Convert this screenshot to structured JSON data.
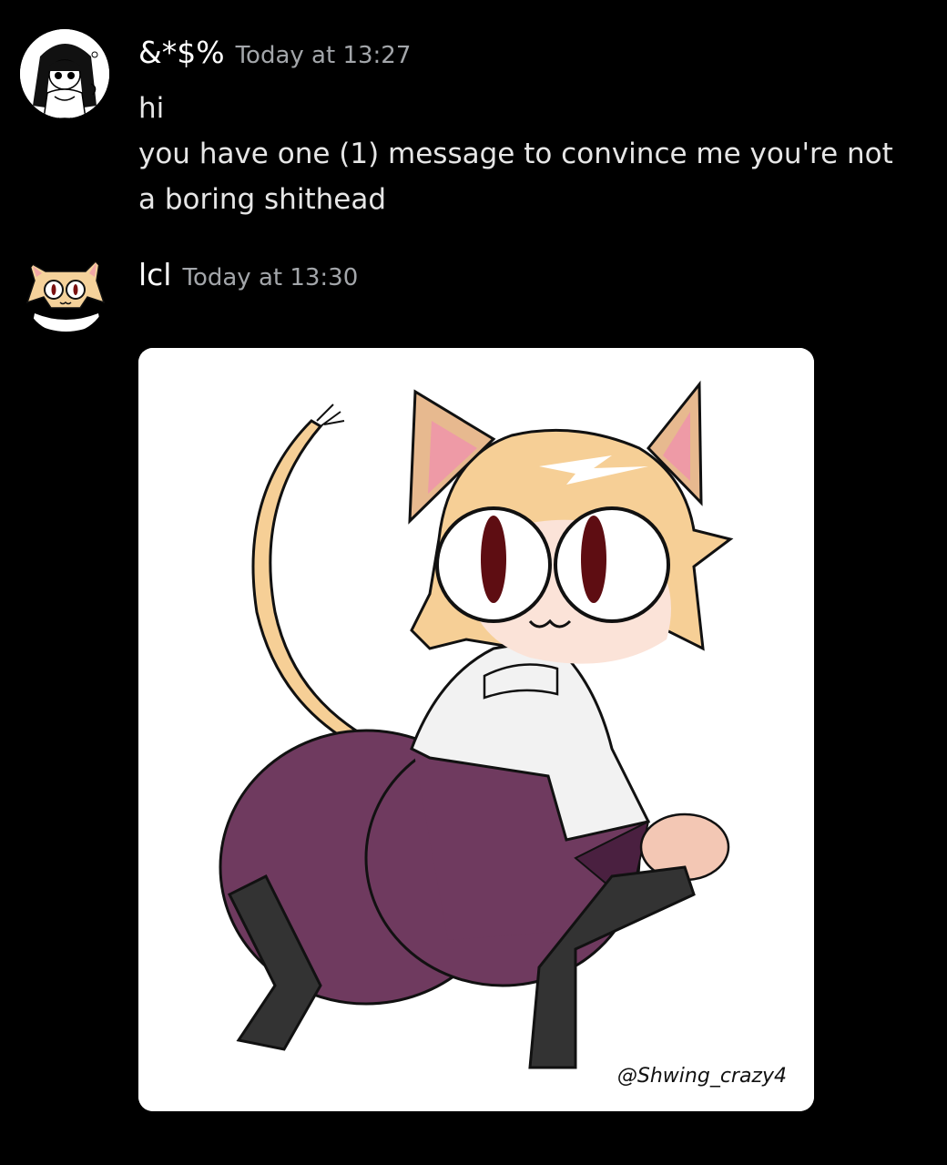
{
  "messages": [
    {
      "username": "&*$%",
      "timestamp": "Today at 13:27",
      "lines": [
        "hi",
        "you have one (1) message to convince me you're not a boring shithead"
      ],
      "avatar_icon": "anime-girl-avatar-icon"
    },
    {
      "username": "lcl",
      "timestamp": "Today at 13:30",
      "avatar_icon": "cat-girl-avatar-icon",
      "attachment": {
        "type": "image",
        "description_icon": "cat-girl-drawing-image",
        "watermark": "@Shwing_crazy4"
      }
    }
  ],
  "colors": {
    "background": "#000000",
    "username": "#ffffff",
    "timestamp": "#a3a6aa",
    "text": "#e6e6e6"
  }
}
